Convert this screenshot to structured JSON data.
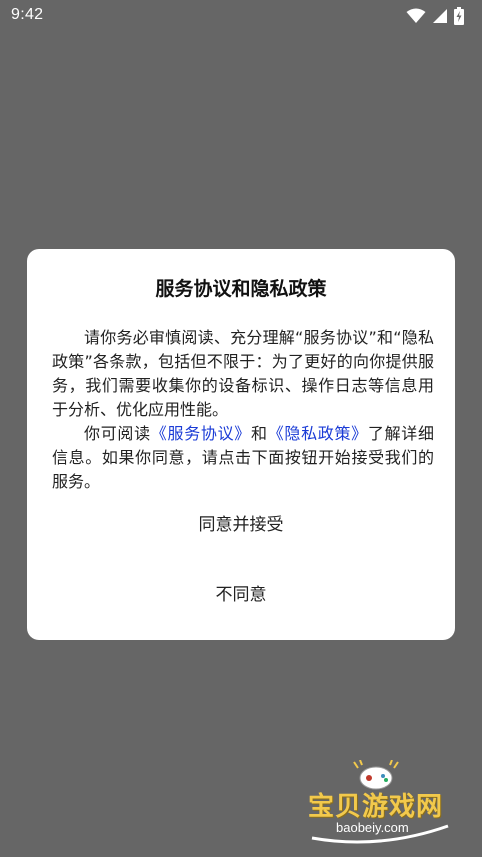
{
  "status_bar": {
    "time": "9:42",
    "icons": [
      "wifi-icon",
      "signal-icon",
      "battery-charging-icon"
    ]
  },
  "dialog": {
    "title": "服务协议和隐私政策",
    "paragraph1": "请你务必审慎阅读、充分理解“服务协议”和“隐私政策”各条款，包括但不限于：为了更好的向你提供服务，我们需要收集你的设备标识、操作日志等信息用于分析、优化应用性能。",
    "paragraph2_prefix": "你可阅读",
    "service_agreement_link": "《服务协议》",
    "paragraph2_and": "和",
    "privacy_policy_link": "《隐私政策》",
    "paragraph2_suffix": "了解详细信息。如果你同意，请点击下面按钮开始接受我们的服务。",
    "accept_button": "同意并接受",
    "decline_button": "不同意"
  },
  "watermark": {
    "brand": "宝贝游戏网",
    "domain": "baobeiy.com"
  },
  "colors": {
    "background": "#666666",
    "dialog": "#ffffff",
    "link": "#1a3bd6",
    "watermark": "#f2c94c"
  }
}
